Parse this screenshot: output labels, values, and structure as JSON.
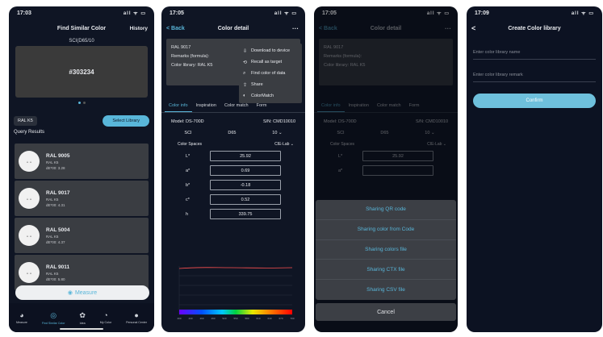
{
  "phone1": {
    "time": "17:03",
    "status_icons": "all ᯤ ▭",
    "title": "Find Similar Color",
    "history": "History",
    "swatch_label": "SCI(D65/10",
    "swatch_value": "#303234",
    "chip": "RAL K5",
    "select_library": "Select Library",
    "query_results": "Query Results",
    "results": [
      {
        "name": "RAL 9005",
        "lib": "RAL K5",
        "de": "dE*00: 3.28"
      },
      {
        "name": "RAL 9017",
        "lib": "RAL K5",
        "de": "dE*00: 4.31"
      },
      {
        "name": "RAL 5004",
        "lib": "RAL K5",
        "de": "dE*00: 4.37"
      },
      {
        "name": "RAL 9011",
        "lib": "RAL K5",
        "de": "dE*00: 5.80"
      }
    ],
    "measure": "Measure",
    "tabs": [
      {
        "glyph": "◕",
        "label": "Measure"
      },
      {
        "glyph": "◎",
        "label": "Find Similar Color"
      },
      {
        "glyph": "✿",
        "label": "Idea"
      },
      {
        "glyph": "◔",
        "label": "My Color"
      },
      {
        "glyph": "●",
        "label": "Personal Center"
      }
    ]
  },
  "phone2": {
    "time": "17:05",
    "back": "< Back",
    "title": "Color detail",
    "more": "···",
    "info": [
      "RAL 9017",
      "Remarks (formula):",
      "Color library: RAL K5"
    ],
    "menu": [
      {
        "glyph": "⇩",
        "label": "Download to device"
      },
      {
        "glyph": "⟲",
        "label": "Recall as target"
      },
      {
        "glyph": "⌕",
        "label": "Find color of data"
      },
      {
        "glyph": "⇪",
        "label": "Share"
      },
      {
        "glyph": "◐",
        "label": "ColorMatch"
      }
    ],
    "tabs": [
      "Color info",
      "Inspiration",
      "Color match",
      "Form"
    ],
    "model": "Model: DS-700D",
    "sn": "S/N: CMD10010",
    "sci": "SCI",
    "illum": "D65",
    "angle": "10",
    "color_space_label": "Color Spaces",
    "color_space_value": "CIE-Lab",
    "values": [
      {
        "key": "L*",
        "val": "25.92"
      },
      {
        "key": "a*",
        "val": "0.69"
      },
      {
        "key": "b*",
        "val": "-0.18"
      },
      {
        "key": "c*",
        "val": "0.52"
      },
      {
        "key": "h",
        "val": "339.75"
      }
    ],
    "spectrum_ticks": [
      "400",
      "430",
      "460",
      "490",
      "520",
      "550",
      "580",
      "610",
      "640",
      "670",
      "700"
    ]
  },
  "phone3": {
    "time": "17:05",
    "back": "< Back",
    "title": "Color detail",
    "more": "···",
    "info": [
      "RAL 9017",
      "Remarks (formula):",
      "Color library: RAL K5"
    ],
    "tabs": [
      "Color info",
      "Inspiration",
      "Color match",
      "Form"
    ],
    "model": "Model: DS-700D",
    "sn": "S/N: CMD10010",
    "sci": "SCI",
    "illum": "D65",
    "angle": "10",
    "color_space_label": "Color Spaces",
    "color_space_value": "CIE-Lab",
    "values": [
      {
        "key": "L*",
        "val": "25.92"
      },
      {
        "key": "a*",
        "val": ""
      }
    ],
    "sheet": [
      "Sharing QR code",
      "Sharing color from Code",
      "Sharing colors file",
      "Sharing CTX file",
      "Sharing CSV file"
    ],
    "cancel": "Cancel"
  },
  "phone4": {
    "time": "17:09",
    "back": "<",
    "title": "Create Color library",
    "name_placeholder": "Enter color library name",
    "remark_placeholder": "Enter color library remark",
    "confirm": "Confirm"
  },
  "colors": {
    "accent": "#59b6d9",
    "bg": "#0f1524",
    "card": "#3a3d42"
  }
}
